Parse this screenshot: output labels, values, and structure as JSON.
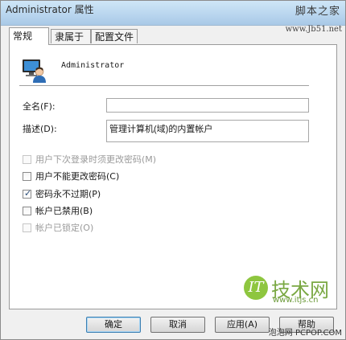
{
  "window": {
    "title": "Administrator 属性"
  },
  "watermarks": {
    "top_brand": "脚本之家",
    "top_url": "www.Jb51.net",
    "logo_mark": "IT",
    "logo_text": "技术网",
    "logo_url": "www.itjs.cn",
    "bottom_credit": "泡泡网 PCPOP.COM"
  },
  "tabs": [
    {
      "label": "常规",
      "active": true
    },
    {
      "label": "隶属于",
      "active": false
    },
    {
      "label": "配置文件",
      "active": false
    }
  ],
  "user": {
    "name": "Administrator",
    "icon": "user-account-icon"
  },
  "fields": {
    "full_name_label": "全名(F):",
    "full_name_value": "",
    "description_label": "描述(D):",
    "description_value": "管理计算机(域)的内置帐户"
  },
  "checkboxes": [
    {
      "label": "用户下次登录时须更改密码(M)",
      "checked": false,
      "enabled": false
    },
    {
      "label": "用户不能更改密码(C)",
      "checked": false,
      "enabled": true
    },
    {
      "label": "密码永不过期(P)",
      "checked": true,
      "enabled": true
    },
    {
      "label": "帐户已禁用(B)",
      "checked": false,
      "enabled": true
    },
    {
      "label": "帐户已锁定(O)",
      "checked": false,
      "enabled": false
    }
  ],
  "buttons": {
    "ok": "确定",
    "cancel": "取消",
    "apply": "应用(A)",
    "help": "帮助"
  },
  "colors": {
    "accent": "#3c7fb1",
    "logo_green": "#8ec63f"
  }
}
